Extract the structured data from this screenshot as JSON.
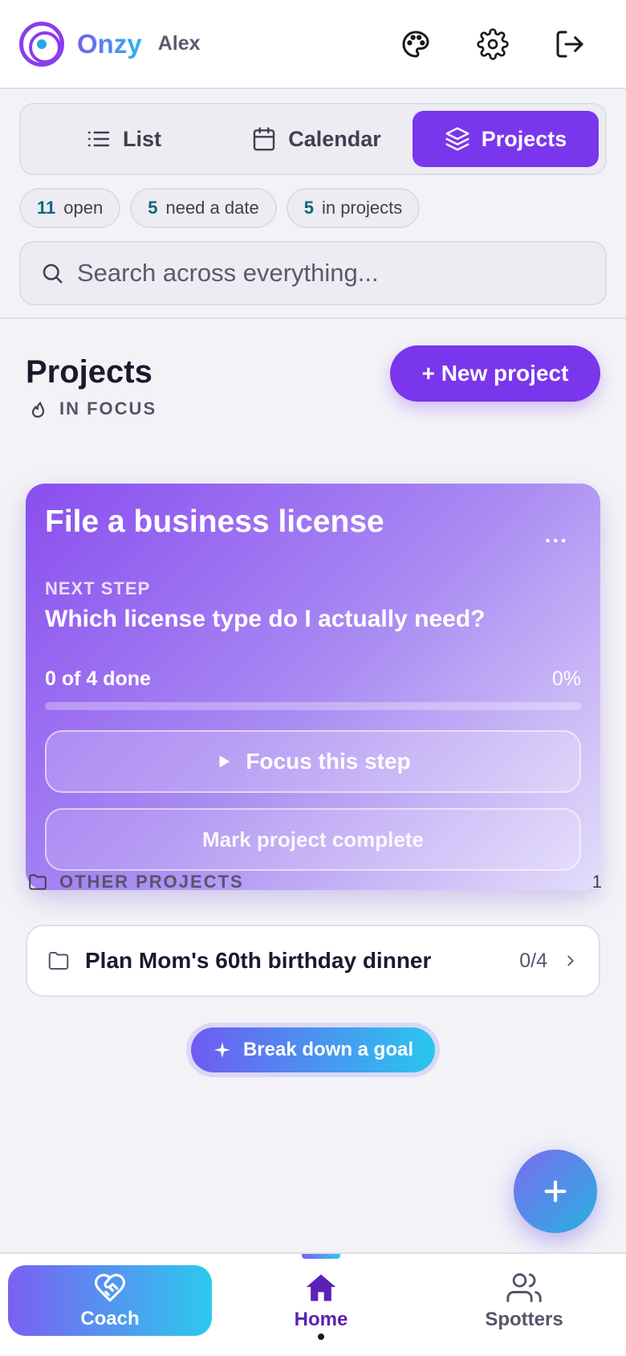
{
  "header": {
    "brand": "Onzy",
    "user": "Alex"
  },
  "view_tabs": [
    {
      "label": "List",
      "icon": "list-icon",
      "active": false
    },
    {
      "label": "Calendar",
      "icon": "calendar-icon",
      "active": false
    },
    {
      "label": "Projects",
      "icon": "layers-icon",
      "active": true
    }
  ],
  "chips": [
    {
      "count": "11",
      "label": "open"
    },
    {
      "count": "5",
      "label": "need a date"
    },
    {
      "count": "5",
      "label": "in projects"
    }
  ],
  "search": {
    "placeholder": "Search across everything..."
  },
  "main": {
    "title": "Projects",
    "new_project_label": "+ New project",
    "in_focus_label": "IN FOCUS",
    "focus_card": {
      "title": "File a business license",
      "menu": "...",
      "next_step_label": "NEXT STEP",
      "next_step": "Which license type do I actually need?",
      "progress_text": "0 of 4 done",
      "progress_pct": "0%",
      "progress_fraction": 0,
      "focus_btn": "Focus this step",
      "complete_btn": "Mark project complete"
    },
    "other_projects_label": "OTHER PROJECTS",
    "other_projects_count": "1",
    "projects": [
      {
        "name": "Plan Mom's 60th birthday dinner",
        "progress": "0/4"
      }
    ],
    "breakdown_label": "Break down a goal"
  },
  "nav": {
    "coach": "Coach",
    "home": "Home",
    "spotters": "Spotters"
  },
  "colors": {
    "accent": "#7a36ec",
    "teal": "#11667a",
    "gradient_start": "#7a60f2",
    "gradient_end": "#2ccaee"
  }
}
